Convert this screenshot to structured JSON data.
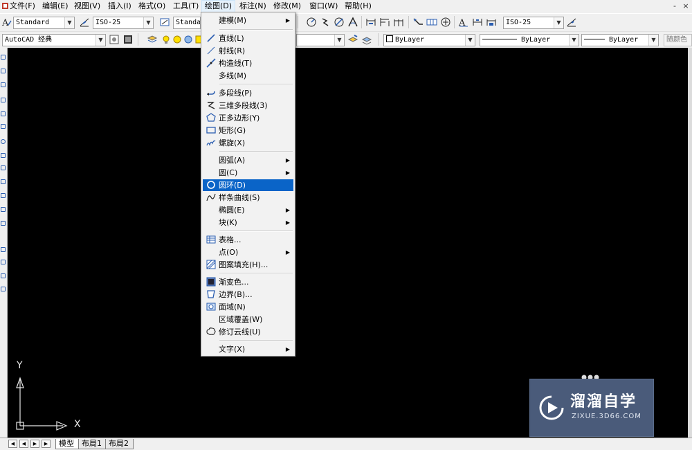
{
  "menubar": {
    "items": [
      "文件(F)",
      "编辑(E)",
      "视图(V)",
      "插入(I)",
      "格式(O)",
      "工具(T)",
      "绘图(D)",
      "标注(N)",
      "修改(M)",
      "窗口(W)",
      "帮助(H)"
    ],
    "active": "绘图(D)",
    "window_controls": [
      "-",
      "×"
    ]
  },
  "toolbar1": {
    "text_style": "Standard",
    "dim_style": "ISO-25",
    "table_style": "Standar",
    "multileader_style": "ISO-25"
  },
  "toolbar2": {
    "workspace": "AutoCAD 经典",
    "color": "ByLayer",
    "linetype": "ByLayer",
    "lineweight": "ByLayer",
    "plotstyle": "随颜色"
  },
  "draw_menu": {
    "items": [
      {
        "label": "建模(M)",
        "submenu": true,
        "icon": ""
      },
      {
        "separator": true
      },
      {
        "label": "直线(L)",
        "icon": "line-icon"
      },
      {
        "label": "射线(R)",
        "icon": "ray-icon"
      },
      {
        "label": "构造线(T)",
        "icon": "xline-icon"
      },
      {
        "label": "多线(M)",
        "icon": ""
      },
      {
        "separator": true
      },
      {
        "label": "多段线(P)",
        "icon": "polyline-icon"
      },
      {
        "label": "三维多段线(3)",
        "icon": "3dpolyline-icon"
      },
      {
        "label": "正多边形(Y)",
        "icon": "polygon-icon"
      },
      {
        "label": "矩形(G)",
        "icon": "rectangle-icon"
      },
      {
        "label": "螺旋(X)",
        "icon": "helix-icon"
      },
      {
        "separator": true
      },
      {
        "label": "圆弧(A)",
        "submenu": true,
        "icon": ""
      },
      {
        "label": "圆(C)",
        "submenu": true,
        "icon": ""
      },
      {
        "label": "圆环(D)",
        "icon": "donut-icon",
        "highlighted": true
      },
      {
        "label": "样条曲线(S)",
        "icon": "spline-icon"
      },
      {
        "label": "椭圆(E)",
        "submenu": true,
        "icon": ""
      },
      {
        "label": "块(K)",
        "submenu": true,
        "icon": ""
      },
      {
        "separator": true
      },
      {
        "label": "表格...",
        "icon": "table-icon"
      },
      {
        "label": "点(O)",
        "submenu": true,
        "icon": ""
      },
      {
        "label": "图案填充(H)...",
        "icon": "hatch-icon"
      },
      {
        "separator": true
      },
      {
        "label": "渐变色...",
        "icon": "gradient-icon"
      },
      {
        "label": "边界(B)...",
        "icon": "boundary-icon"
      },
      {
        "label": "面域(N)",
        "icon": "region-icon"
      },
      {
        "label": "区域覆盖(W)",
        "icon": ""
      },
      {
        "label": "修订云线(U)",
        "icon": "revcloud-icon"
      },
      {
        "separator": true
      },
      {
        "label": "文字(X)",
        "submenu": true,
        "icon": ""
      }
    ]
  },
  "ucs": {
    "x_label": "X",
    "y_label": "Y"
  },
  "layout_tabs": [
    "模型",
    "布局1",
    "布局2"
  ],
  "active_tab": "模型",
  "watermark": {
    "title": "溜溜自学",
    "subtitle": "ZIXUE.3D66.COM"
  },
  "colors": {
    "canvas": "#000000",
    "highlight": "#0a64c8",
    "watermark_bg": "#4a5b7a"
  }
}
